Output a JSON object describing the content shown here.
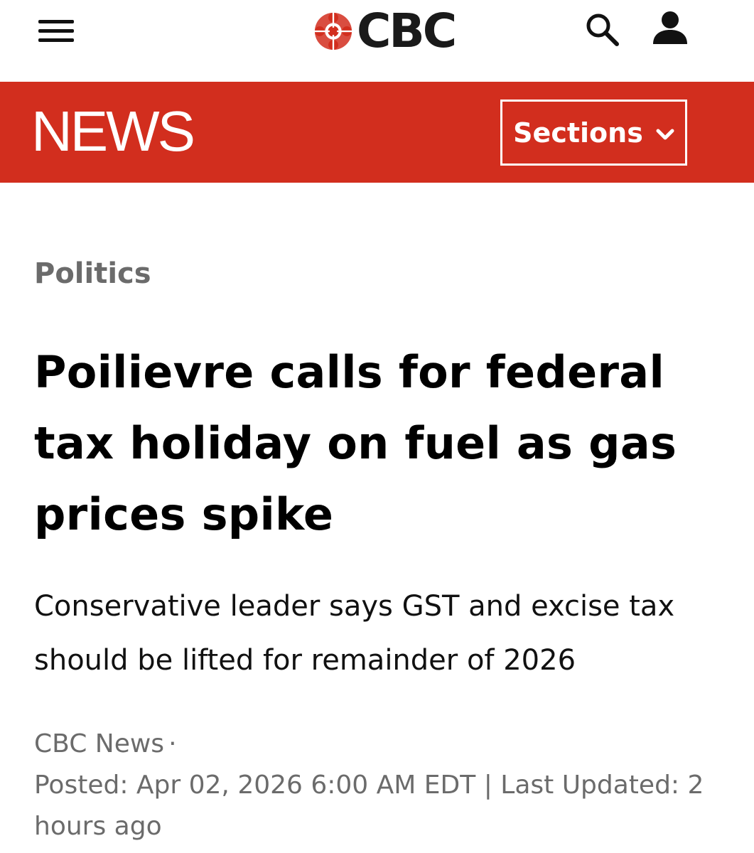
{
  "header": {
    "logo_text": "CBC",
    "icons": {
      "menu": "hamburger-menu-icon",
      "logo": "cbc-gem-logo",
      "search": "search-icon",
      "profile": "user-icon"
    }
  },
  "newsbar": {
    "title": "NEWS",
    "sections_label": "Sections",
    "color": "#d22e1e"
  },
  "article": {
    "category": "Politics",
    "headline": "Poilievre calls for federal tax holiday on fuel as gas prices spike",
    "deck": "Conservative leader says GST and excise tax should be lifted for remainder of 2026",
    "byline": "CBC News",
    "byline_sep": "·",
    "posted": "Posted: Apr 02, 2026 6:00 AM EDT | Last Updated: 2 hours ago"
  }
}
